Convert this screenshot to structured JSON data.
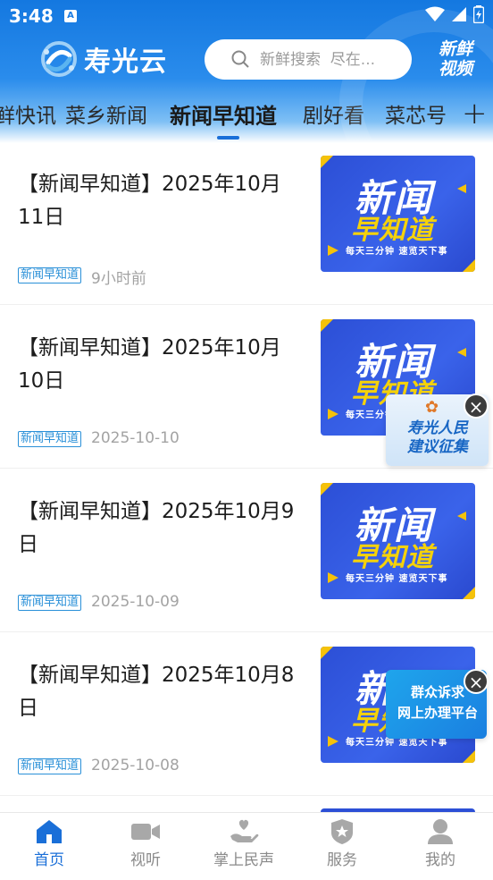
{
  "status_bar": {
    "time": "3:48",
    "notification_letter": "A"
  },
  "header": {
    "logo_text": "寿光云",
    "search_placeholder": "新鲜搜索  尽在...",
    "video_button_line1": "新鲜",
    "video_button_line2": "视频"
  },
  "tabs": [
    {
      "label": "鲜快讯",
      "active": false
    },
    {
      "label": "菜乡新闻",
      "active": false
    },
    {
      "label": "新闻早知道",
      "active": true
    },
    {
      "label": "剧好看",
      "active": false
    },
    {
      "label": "菜芯号",
      "active": false
    }
  ],
  "tab_add_label": "+",
  "thumbnail": {
    "line1": "新闻",
    "line2": "早知道",
    "line3": "每天三分钟  速览天下事"
  },
  "articles": [
    {
      "title": "【新闻早知道】2025年10月11日",
      "tag": "新闻早知道",
      "time": "9小时前"
    },
    {
      "title": "【新闻早知道】2025年10月10日",
      "tag": "新闻早知道",
      "time": "2025-10-10"
    },
    {
      "title": "【新闻早知道】2025年10月9日",
      "tag": "新闻早知道",
      "time": "2025-10-09"
    },
    {
      "title": "【新闻早知道】2025年10月8日",
      "tag": "新闻早知道",
      "time": "2025-10-08"
    }
  ],
  "floating_ads": {
    "ad1_line1": "寿光人民",
    "ad1_line2": "建议征集",
    "ad2_line1": "群众诉求",
    "ad2_line2": "网上办理平台",
    "close_symbol": "×"
  },
  "bottom_nav": [
    {
      "label": "首页",
      "icon": "home-icon",
      "active": true
    },
    {
      "label": "视听",
      "icon": "video-camera-icon",
      "active": false
    },
    {
      "label": "掌上民声",
      "icon": "hand-heart-icon",
      "active": false
    },
    {
      "label": "服务",
      "icon": "service-badge-icon",
      "active": false
    },
    {
      "label": "我的",
      "icon": "user-icon",
      "active": false
    }
  ],
  "colors": {
    "brand_blue": "#1478e0",
    "active_tab_indicator": "#1a6fd8",
    "tag_blue": "#2a90d8",
    "thumb_blue": "#2c4fd6",
    "thumb_yellow": "#f5d20a"
  }
}
